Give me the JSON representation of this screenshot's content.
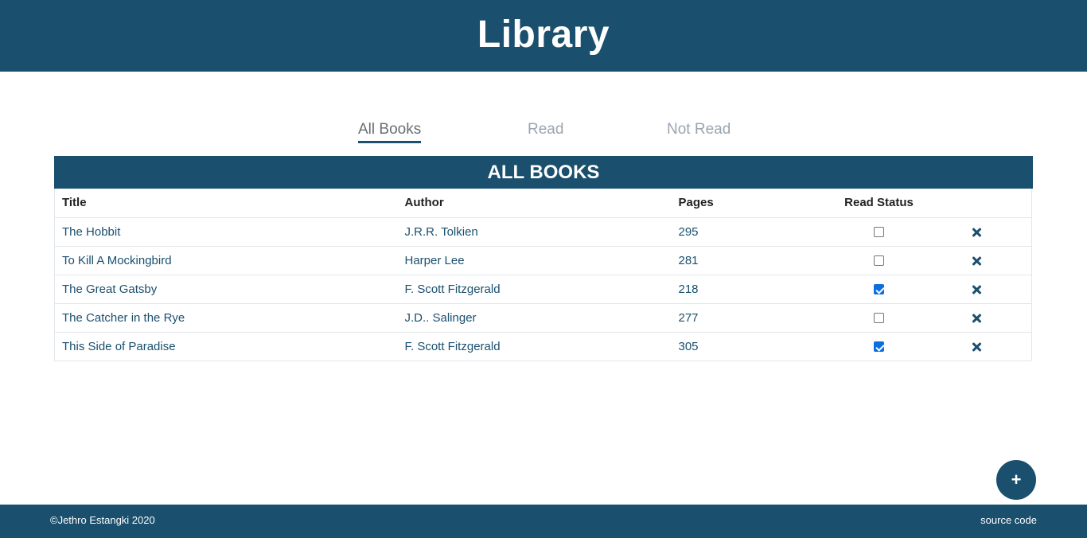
{
  "header": {
    "title": "Library"
  },
  "tabs": [
    {
      "label": "All Books",
      "active": true
    },
    {
      "label": "Read",
      "active": false
    },
    {
      "label": "Not Read",
      "active": false
    }
  ],
  "table": {
    "banner": "ALL BOOKS",
    "columns": [
      "Title",
      "Author",
      "Pages",
      "Read Status"
    ],
    "rows": [
      {
        "title": "The Hobbit",
        "author": "J.R.R. Tolkien",
        "pages": "295",
        "read": false
      },
      {
        "title": "To Kill A Mockingbird",
        "author": "Harper Lee",
        "pages": "281",
        "read": false
      },
      {
        "title": "The Great Gatsby",
        "author": "F. Scott Fitzgerald",
        "pages": "218",
        "read": true
      },
      {
        "title": "The Catcher in the Rye",
        "author": "J.D.. Salinger",
        "pages": "277",
        "read": false
      },
      {
        "title": "This Side of Paradise",
        "author": "F. Scott Fitzgerald",
        "pages": "305",
        "read": true
      }
    ],
    "delete_icon": "close-icon"
  },
  "fab": {
    "label": "+",
    "icon": "plus-icon"
  },
  "footer": {
    "copyright": "©Jethro Estangki 2020",
    "source_link": "source code"
  },
  "colors": {
    "primary": "#1a4f6e",
    "checkbox": "#0b6fe0",
    "tab_inactive": "#9aa5b1"
  }
}
